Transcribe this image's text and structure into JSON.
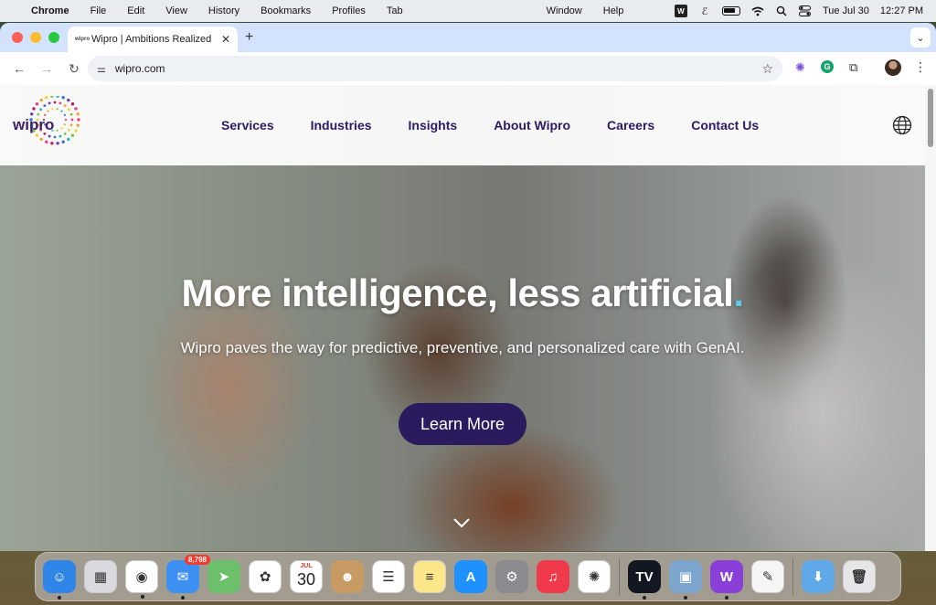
{
  "menubar": {
    "app": "Chrome",
    "items": [
      "File",
      "Edit",
      "View",
      "History",
      "Bookmarks",
      "Profiles",
      "Tab"
    ],
    "right_items": [
      "Window",
      "Help"
    ],
    "date": "Tue Jul 30",
    "time": "12:27 PM"
  },
  "browser": {
    "tab_title": "Wipro | Ambitions Realized",
    "tab_favicon": "wipro",
    "url": "wipro.com"
  },
  "site": {
    "logo": "wipro",
    "nav": [
      "Services",
      "Industries",
      "Insights",
      "About Wipro",
      "Careers",
      "Contact Us"
    ],
    "hero_title": "More intelligence, less artificial",
    "hero_title_dot": ".",
    "hero_subtitle": "Wipro paves the way for predictive, preventive, and personalized care with GenAI.",
    "cta_label": "Learn More"
  },
  "dock": {
    "apps": [
      {
        "name": "Finder",
        "color": "#2f86e8",
        "glyph": "☺",
        "running": true
      },
      {
        "name": "Launchpad",
        "color": "#d9d9de",
        "glyph": "▦",
        "running": false
      },
      {
        "name": "Chrome",
        "color": "#ffffff",
        "glyph": "◉",
        "running": true
      },
      {
        "name": "Mail",
        "color": "#3d8ff2",
        "glyph": "✉",
        "running": true,
        "badge": "8,798"
      },
      {
        "name": "Maps",
        "color": "#6cc06b",
        "glyph": "➤",
        "running": false
      },
      {
        "name": "Photos",
        "color": "#ffffff",
        "glyph": "✿",
        "running": false
      },
      {
        "name": "Calendar",
        "color": "#ffffff",
        "month": "JUL",
        "day": "30",
        "running": false
      },
      {
        "name": "Contacts",
        "color": "#c89a64",
        "glyph": "☻",
        "running": false
      },
      {
        "name": "Reminders",
        "color": "#ffffff",
        "glyph": "☰",
        "running": false
      },
      {
        "name": "Notes",
        "color": "#fbe68a",
        "glyph": "≡",
        "running": false
      },
      {
        "name": "App Store",
        "color": "#1e90ff",
        "glyph": "A",
        "running": false
      },
      {
        "name": "System Settings",
        "color": "#8a8a8f",
        "glyph": "⚙",
        "running": false
      },
      {
        "name": "Music",
        "color": "#f0394a",
        "glyph": "♫",
        "running": false
      },
      {
        "name": "ChatGPT",
        "color": "#ffffff",
        "glyph": "✺",
        "running": false
      },
      {
        "name": "TradingView",
        "color": "#131722",
        "glyph": "TV",
        "running": true
      },
      {
        "name": "Preview",
        "color": "#7da6cf",
        "glyph": "▣",
        "running": true
      },
      {
        "name": "Wondershare",
        "color": "#8b3fd9",
        "glyph": "W",
        "running": true
      },
      {
        "name": "TextEdit",
        "color": "#f5f5f5",
        "glyph": "✎",
        "running": false
      },
      {
        "name": "Downloads",
        "color": "#5fa9e8",
        "glyph": "⬇",
        "running": false
      },
      {
        "name": "Trash",
        "color": "#e6e6e8",
        "glyph": "🗑",
        "running": false
      }
    ]
  }
}
